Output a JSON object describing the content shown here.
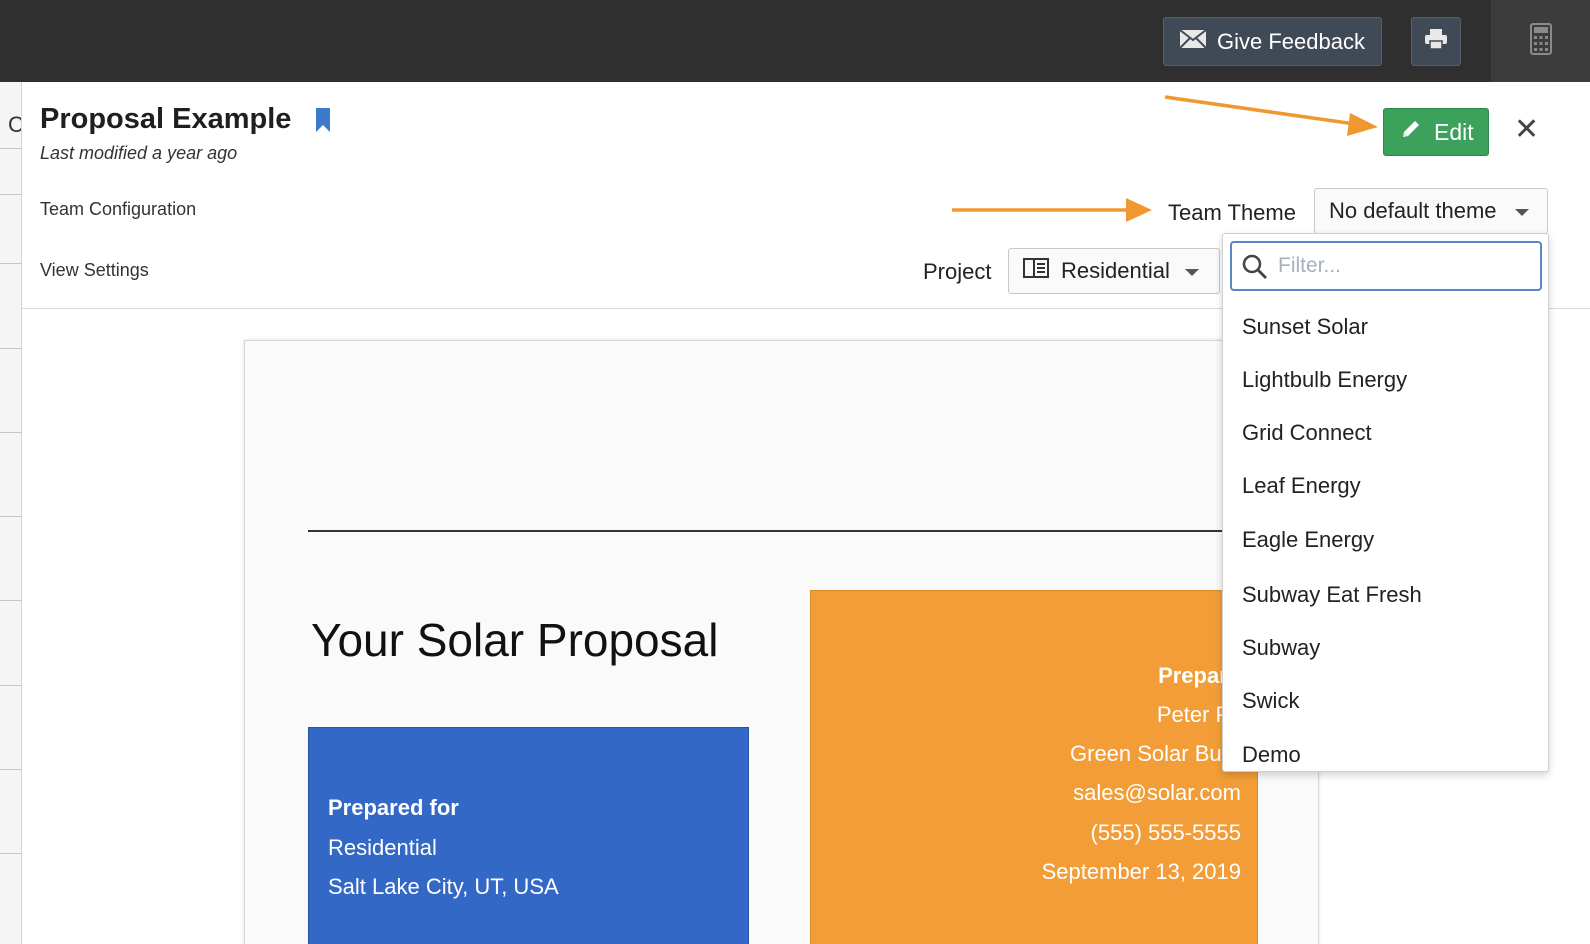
{
  "topbar": {
    "feedback_label": "Give Feedback",
    "icons": [
      "mail-icon",
      "print-icon",
      "calculator-icon"
    ]
  },
  "background": {
    "left_edge_text": "C"
  },
  "header": {
    "title": "Proposal Example",
    "subtitle": "Last modified a year ago",
    "team_configuration": "Team Configuration",
    "view_settings": "View Settings",
    "edit_label": "Edit",
    "close_label": "✕"
  },
  "team_theme": {
    "label": "Team Theme",
    "selected": "No default theme"
  },
  "project": {
    "label": "Project",
    "selected": "Residential"
  },
  "dropdown": {
    "filter_placeholder": "Filter...",
    "options": [
      "Sunset Solar",
      "Lightbulb Energy",
      "Grid Connect",
      "Leaf Energy",
      "Eagle Energy",
      "Subway Eat Fresh",
      "Subway",
      "Swick",
      "Demo"
    ]
  },
  "document": {
    "title": "Your Solar Proposal",
    "prepared_for": {
      "heading": "Prepared for",
      "name": "Residential",
      "location": "Salt Lake City, UT, USA"
    },
    "prepared_by": {
      "heading": "Prepared b",
      "name": "Peter Parke",
      "company": "Green Solar Busines",
      "email": "sales@solar.com",
      "phone": "(555) 555-5555",
      "date": "September 13, 2019"
    }
  },
  "colors": {
    "topbar": "#2f2f30",
    "edit_green": "#3ca15a",
    "bookmark_blue": "#3b7bc8",
    "arrow_orange": "#f0982f",
    "blue_box": "#3468c6",
    "orange_box": "#f29d38"
  }
}
